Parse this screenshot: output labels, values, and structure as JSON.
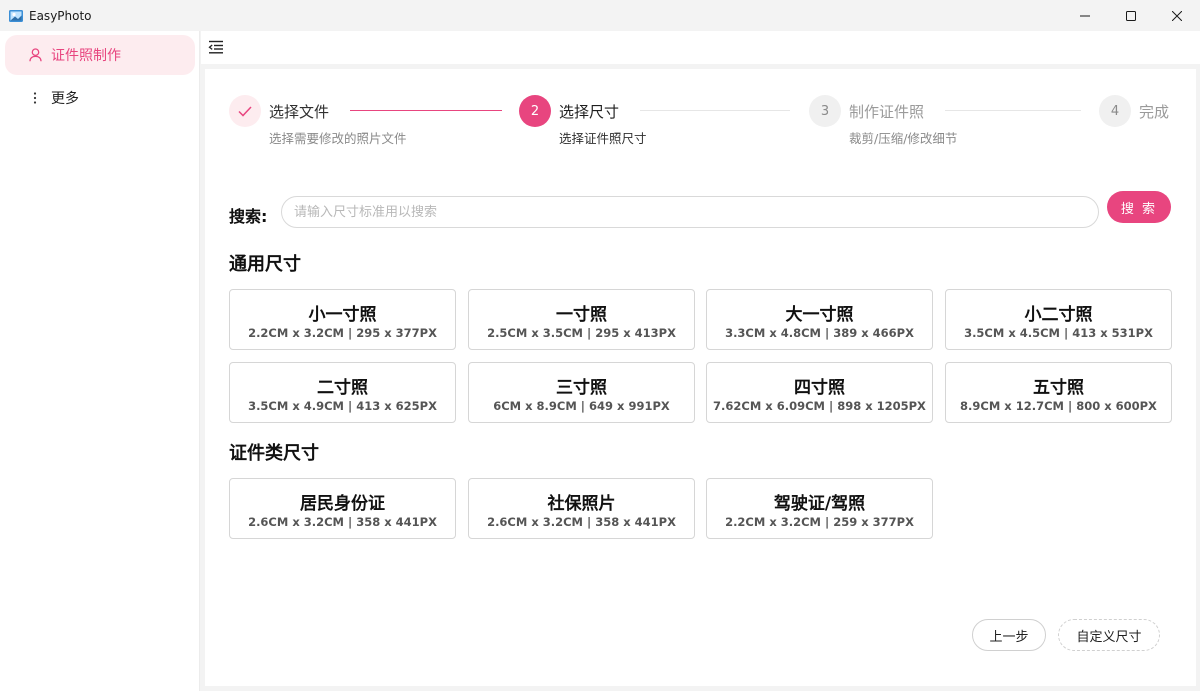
{
  "app": {
    "title": "EasyPhoto"
  },
  "sidebar": {
    "items": [
      {
        "label": "证件照制作",
        "icon": "user-icon",
        "active": true
      },
      {
        "label": "更多",
        "icon": "more-vertical-icon",
        "active": false
      }
    ]
  },
  "steps": [
    {
      "number": "1",
      "title": "选择文件",
      "desc": "选择需要修改的照片文件",
      "status": "done"
    },
    {
      "number": "2",
      "title": "选择尺寸",
      "desc": "选择证件照尺寸",
      "status": "active"
    },
    {
      "number": "3",
      "title": "制作证件照",
      "desc": "裁剪/压缩/修改细节",
      "status": "wait"
    },
    {
      "number": "4",
      "title": "完成",
      "desc": "",
      "status": "wait"
    }
  ],
  "search": {
    "label": "搜索:",
    "placeholder": "请输入尺寸标准用以搜索",
    "value": "",
    "button": "搜 索"
  },
  "sections": [
    {
      "title": "通用尺寸",
      "items": [
        {
          "name": "小一寸照",
          "spec": "2.2CM x 3.2CM | 295 x 377PX"
        },
        {
          "name": "一寸照",
          "spec": "2.5CM x 3.5CM | 295 x 413PX"
        },
        {
          "name": "大一寸照",
          "spec": "3.3CM x 4.8CM | 389 x 466PX"
        },
        {
          "name": "小二寸照",
          "spec": "3.5CM x 4.5CM | 413 x 531PX"
        },
        {
          "name": "二寸照",
          "spec": "3.5CM x 4.9CM | 413 x 625PX"
        },
        {
          "name": "三寸照",
          "spec": "6CM x 8.9CM | 649 x 991PX"
        },
        {
          "name": "四寸照",
          "spec": "7.62CM x 6.09CM | 898 x 1205PX"
        },
        {
          "name": "五寸照",
          "spec": "8.9CM x 12.7CM | 800 x 600PX"
        }
      ]
    },
    {
      "title": "证件类尺寸",
      "items": [
        {
          "name": "居民身份证",
          "spec": "2.6CM x 3.2CM | 358 x 441PX"
        },
        {
          "name": "社保照片",
          "spec": "2.6CM x 3.2CM | 358 x 441PX"
        },
        {
          "name": "驾驶证/驾照",
          "spec": "2.2CM x 3.2CM | 259 x 377PX"
        }
      ]
    }
  ],
  "footer": {
    "prev": "上一步",
    "custom": "自定义尺寸"
  },
  "colors": {
    "accent": "#e8457f",
    "accent_light": "#fdecef",
    "border": "#d6d6d6"
  }
}
